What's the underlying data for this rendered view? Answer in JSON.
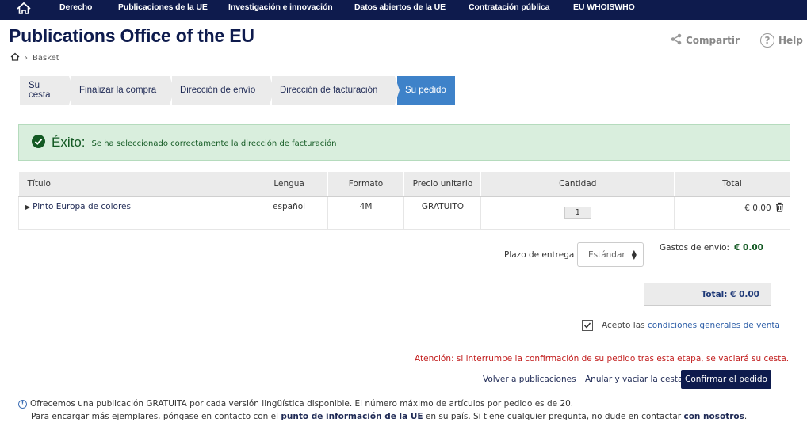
{
  "nav": {
    "items": [
      "Derecho",
      "Publicaciones de la UE",
      "Investigación e innovación",
      "Datos abiertos de la UE",
      "Contratación pública",
      "EU WHOISWHO"
    ]
  },
  "site_title": "Publications Office of the EU",
  "share_label": "Compartir",
  "help_label": "Help",
  "breadcrumb": {
    "current": "Basket"
  },
  "steps": [
    "Su cesta",
    "Finalizar la compra",
    "Dirección de envío",
    "Dirección de facturación",
    "Su pedido"
  ],
  "success": {
    "title": "Éxito:",
    "message": "Se ha seleccionado correctamente la dirección de facturación"
  },
  "table": {
    "headers": {
      "title": "Título",
      "language": "Lengua",
      "format": "Formato",
      "unit_price": "Precio unitario",
      "quantity": "Cantidad",
      "total": "Total"
    },
    "rows": [
      {
        "title": "Pinto Europa de colores",
        "language": "español",
        "format": "4M",
        "unit_price": "GRATUITO",
        "quantity": "1",
        "total": "€ 0.00"
      }
    ]
  },
  "delivery": {
    "label": "Plazo de entrega",
    "selected": "Estándar"
  },
  "shipping": {
    "label": "Gastos de envío:",
    "value": "€ 0.00"
  },
  "total_label": "Total: € 0.00",
  "terms": {
    "prefix": "Acepto las",
    "link": "condiciones generales de venta",
    "checked": true
  },
  "warning": "Atención: si interrumpe la confirmación de su pedido tras esta etapa, se vaciará su cesta.",
  "buttons": {
    "back": "Volver a publicaciones",
    "cancel": "Anular y vaciar la cesta",
    "confirm": "Confirmar el pedido"
  },
  "info": {
    "line1": "Ofrecemos una publicación GRATUITA por cada versión lingüística disponible. El número máximo de artículos por pedido es de 20.",
    "line2_prefix": "Para encargar más ejemplares, póngase en contacto con el",
    "line2_link": "punto de información de la UE",
    "line2_middle": "en su país. Si tiene cualquier pregunta, no dude en contactar",
    "line2_link2": "con nosotros",
    "line2_end": "."
  },
  "colors": {
    "nav_bg": "#0e1b4d",
    "active_step": "#3e82c9",
    "success_bg": "#d9eedd",
    "warning": "#c21e1e"
  }
}
